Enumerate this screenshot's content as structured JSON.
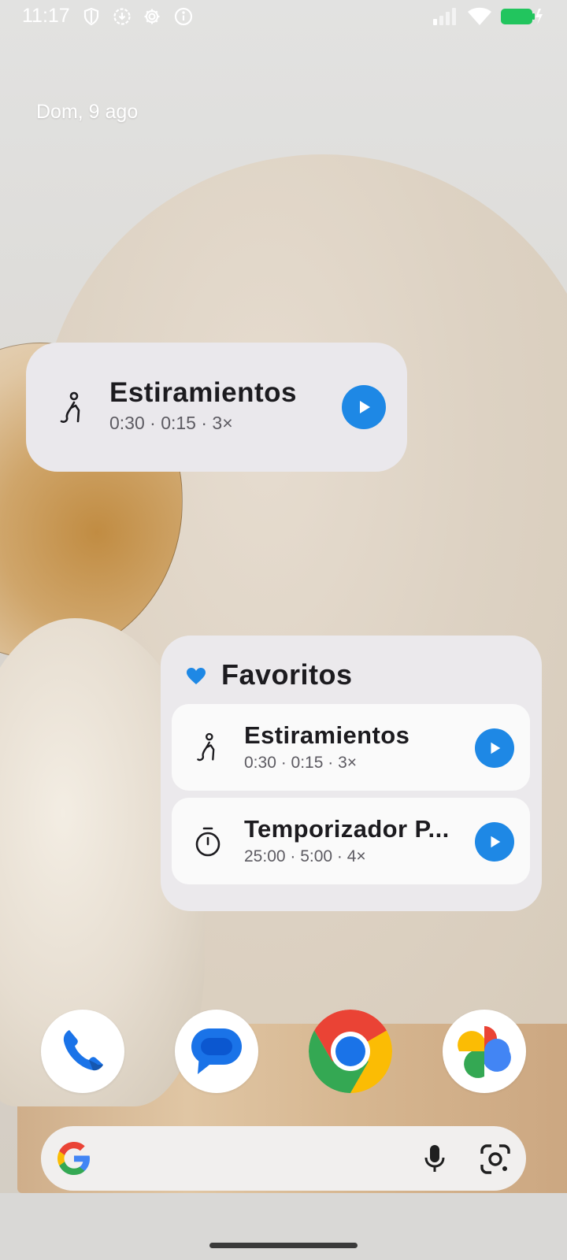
{
  "status_bar": {
    "time": "11:17",
    "left_icons": [
      "shield-icon",
      "download-icon",
      "settings-icon",
      "info-icon"
    ],
    "right_icons": [
      "signal-icon",
      "wifi-icon",
      "battery-charging-icon"
    ]
  },
  "date": "Dom, 9 ago",
  "widget_single": {
    "icon": "stretching-figure-icon",
    "title": "Estiramientos",
    "meta": "0:30  ·  0:15  ·  3×"
  },
  "widget_favorites": {
    "title": "Favoritos",
    "items": [
      {
        "icon": "stretching-figure-icon",
        "title": "Estiramientos",
        "meta": "0:30  ·  0:15  ·  3×"
      },
      {
        "icon": "stopwatch-icon",
        "title": "Temporizador P...",
        "meta": "25:00  ·  5:00  ·  4×"
      }
    ]
  },
  "dock": [
    "Phone",
    "Messages",
    "Chrome",
    "Photos"
  ],
  "search_bar": {
    "icons": [
      "google-logo",
      "microphone-icon",
      "google-lens-icon"
    ]
  },
  "colors": {
    "accent": "#1e88e5",
    "widget_bg": "#eae8ec",
    "item_bg": "#fafafa"
  }
}
